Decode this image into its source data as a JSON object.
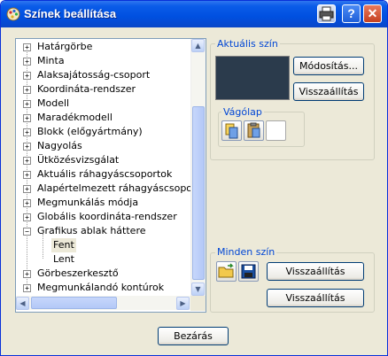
{
  "window": {
    "title": "Színek beállítása"
  },
  "tree": {
    "items": [
      {
        "label": "Határgörbe",
        "expander": "+"
      },
      {
        "label": "Minta",
        "expander": "+"
      },
      {
        "label": "Alaksajátosság-csoport",
        "expander": "+"
      },
      {
        "label": "Koordináta-rendszer",
        "expander": "+"
      },
      {
        "label": "Modell",
        "expander": "+"
      },
      {
        "label": "Maradékmodell",
        "expander": "+"
      },
      {
        "label": "Blokk (előgyártmány)",
        "expander": "+"
      },
      {
        "label": "Nagyolás",
        "expander": "+"
      },
      {
        "label": "Ütközésvizsgálat",
        "expander": "+"
      },
      {
        "label": "Aktuális ráhagyáscsoportok",
        "expander": "+"
      },
      {
        "label": "Alapértelmezett ráhagyáscsoportok",
        "expander": "+"
      },
      {
        "label": "Megmunkálás módja",
        "expander": "+"
      },
      {
        "label": "Globális koordináta-rendszer",
        "expander": "+"
      },
      {
        "label": "Grafikus ablak háttere",
        "expander": "−"
      },
      {
        "label": "Fent",
        "child": true,
        "selected": true
      },
      {
        "label": "Lent",
        "child": true
      },
      {
        "label": "Görbeszerkesztő",
        "expander": "+"
      },
      {
        "label": "Megmunkálandó kontúrok",
        "expander": "+"
      }
    ]
  },
  "current_color": {
    "title": "Aktuális szín",
    "swatch_color": "#2b3b4c",
    "modify_label": "Módosítás...",
    "reset_label": "Visszaállítás"
  },
  "clipboard": {
    "title": "Vágólap"
  },
  "all_colors": {
    "title": "Minden szín",
    "reset_label_1": "Visszaállítás",
    "reset_label_2": "Visszaállítás"
  },
  "footer": {
    "close_label": "Bezárás"
  }
}
